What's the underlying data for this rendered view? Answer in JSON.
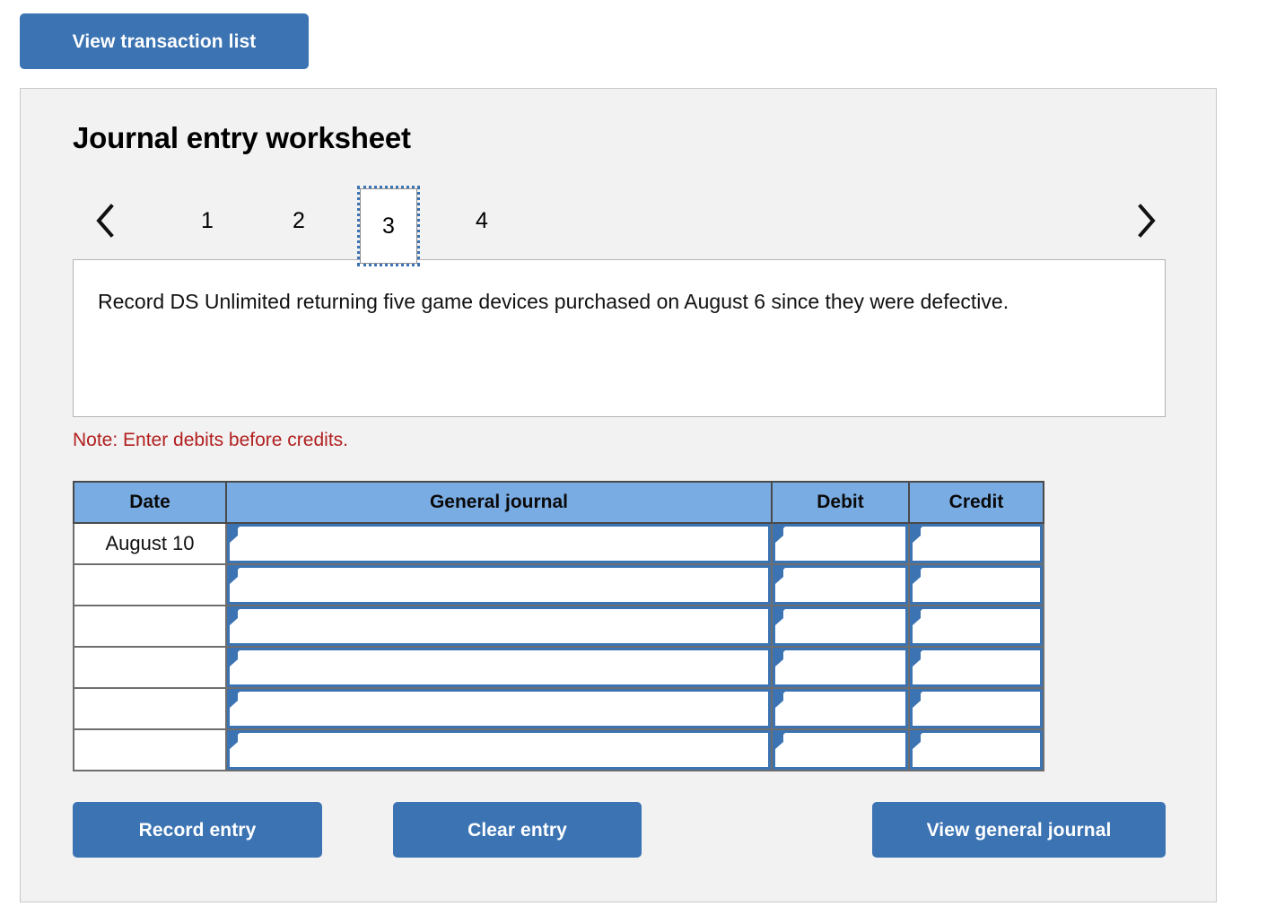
{
  "top": {
    "view_transaction_list_label": "View transaction list"
  },
  "worksheet": {
    "title": "Journal entry worksheet",
    "tabs": [
      {
        "label": "1",
        "active": false
      },
      {
        "label": "2",
        "active": false
      },
      {
        "label": "3",
        "active": true
      },
      {
        "label": "4",
        "active": false
      }
    ],
    "prev_arrow_icon": "chevron-left-icon",
    "next_arrow_icon": "chevron-right-icon",
    "description": "Record DS Unlimited returning five game devices purchased on August 6 since they were defective.",
    "note": "Note: Enter debits before credits."
  },
  "journal_table": {
    "headers": [
      "Date",
      "General journal",
      "Debit",
      "Credit"
    ],
    "rows": [
      {
        "date": "August 10",
        "general_journal": "",
        "debit": "",
        "credit": ""
      },
      {
        "date": "",
        "general_journal": "",
        "debit": "",
        "credit": ""
      },
      {
        "date": "",
        "general_journal": "",
        "debit": "",
        "credit": ""
      },
      {
        "date": "",
        "general_journal": "",
        "debit": "",
        "credit": ""
      },
      {
        "date": "",
        "general_journal": "",
        "debit": "",
        "credit": ""
      },
      {
        "date": "",
        "general_journal": "",
        "debit": "",
        "credit": ""
      }
    ]
  },
  "actions": {
    "record_entry_label": "Record entry",
    "clear_entry_label": "Clear entry",
    "view_general_journal_label": "View general journal"
  },
  "colors": {
    "button_blue": "#3b73b3",
    "table_header_blue": "#7aace4",
    "input_border_blue": "#3b73b3",
    "note_red": "#b21f1f",
    "panel_bg": "#f2f2f2",
    "panel_border": "#c9c9c9"
  }
}
